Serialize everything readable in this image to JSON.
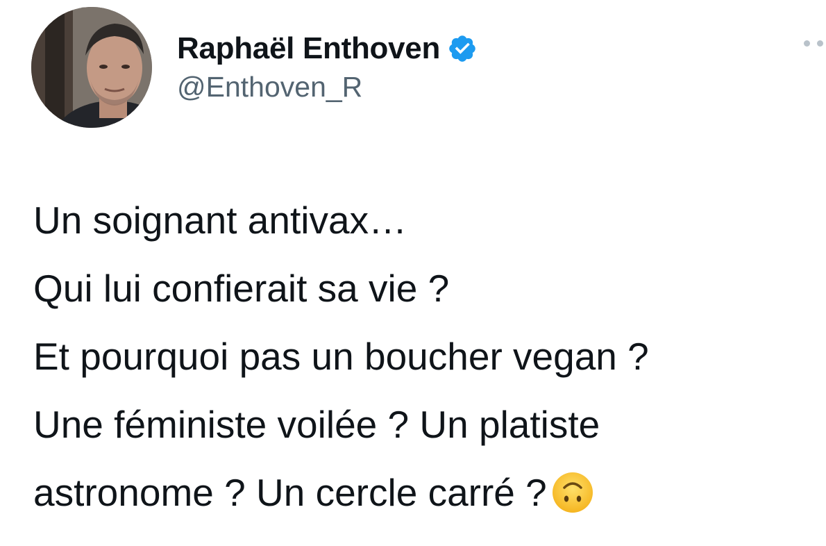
{
  "author": {
    "display_name": "Raphaël Enthoven",
    "handle": "@Enthoven_R",
    "verified": true,
    "verified_color": "#1d9bf0"
  },
  "tweet": {
    "lines": [
      "Un soignant antivax…",
      "Qui lui confierait sa vie ?",
      "Et pourquoi pas un boucher vegan ?",
      "Une féministe voilée ? Un platiste",
      "astronome ? Un cercle carré ?"
    ],
    "emoji": "upside-down-face-icon"
  },
  "colors": {
    "text": "#0f1419",
    "secondary_text": "#536471",
    "background": "#ffffff"
  }
}
